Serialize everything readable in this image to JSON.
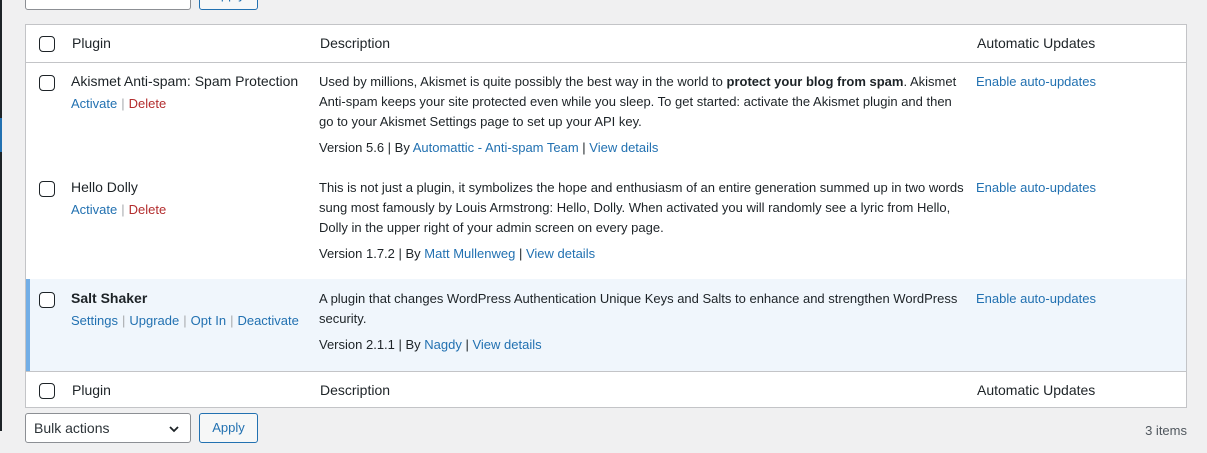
{
  "bulk_actions": {
    "select_label": "Bulk actions",
    "apply_label": "Apply",
    "items_count": "3 items"
  },
  "table": {
    "columns": {
      "plugin": "Plugin",
      "description": "Description",
      "auto_updates": "Automatic Updates"
    },
    "rows": [
      {
        "name": "Akismet Anti-spam: Spam Protection",
        "actions": [
          "Activate",
          "Delete"
        ],
        "description_before": "Used by millions, Akismet is quite possibly the best way in the world to ",
        "description_bold": "protect your blog from spam",
        "description_after": ". Akismet Anti-spam keeps your site protected even while you sleep. To get started: activate the Akismet plugin and then go to your Akismet Settings page to set up your API key.",
        "version": "Version 5.6",
        "by": "By",
        "author": "Automattic - Anti-spam Team",
        "view_details": "View details",
        "auto_update": "Enable auto-updates"
      },
      {
        "name": "Hello Dolly",
        "actions": [
          "Activate",
          "Delete"
        ],
        "description": "This is not just a plugin, it symbolizes the hope and enthusiasm of an entire generation summed up in two words sung most famously by Louis Armstrong: Hello, Dolly. When activated you will randomly see a lyric from Hello, Dolly in the upper right of your admin screen on every page.",
        "version": "Version 1.7.2",
        "by": "By",
        "author": "Matt Mullenweg",
        "view_details": "View details",
        "auto_update": "Enable auto-updates"
      },
      {
        "name": "Salt Shaker",
        "actions": [
          "Settings",
          "Upgrade",
          "Opt In",
          "Deactivate"
        ],
        "description": "A plugin that changes WordPress Authentication Unique Keys and Salts to enhance and strengthen WordPress security.",
        "version": "Version 2.1.1",
        "by": "By",
        "author": "Nagdy",
        "view_details": "View details",
        "auto_update": "Enable auto-updates",
        "active": true
      }
    ]
  },
  "colors": {
    "link": "#2271b1",
    "delete": "#b32d2e",
    "active_row_bg": "#f0f6fc",
    "active_row_border": "#72aee6"
  }
}
